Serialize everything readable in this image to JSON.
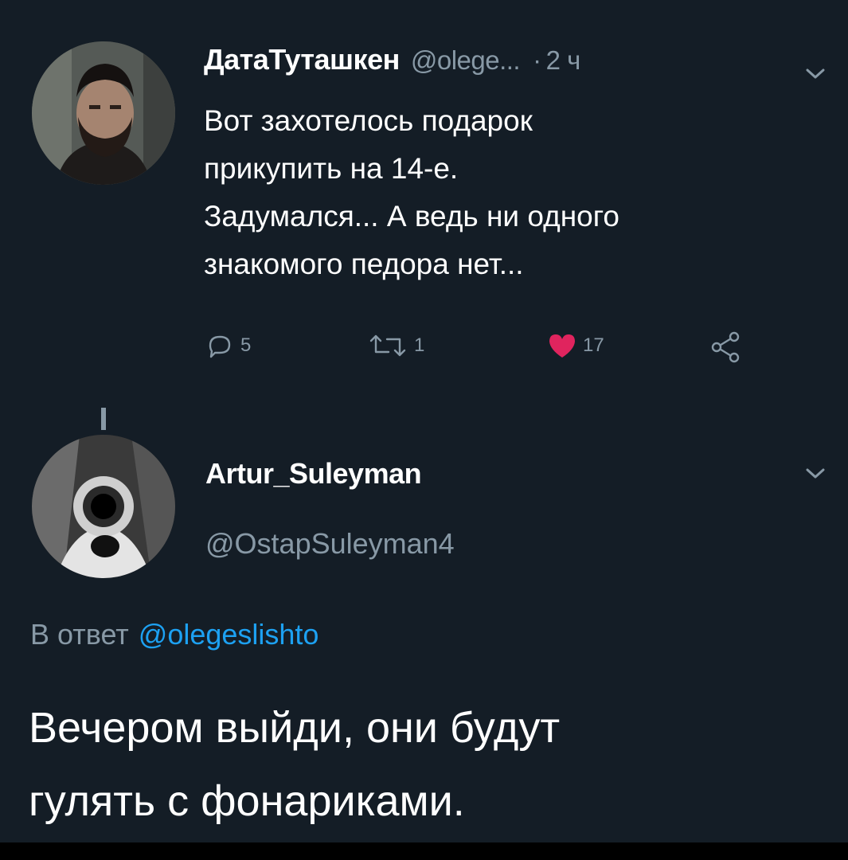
{
  "tweet": {
    "author_name": "ДатаТуташкен",
    "author_handle": "@olege...",
    "separator": "·",
    "time": "2 ч",
    "text": "Вот захотелось подарок\nприкупить на 14-е.\nЗадумался... А ведь ни одного\nзнакомого педора нет...",
    "avatar_icon": "bearded-man-avatar",
    "actions": {
      "reply_count": "5",
      "retweet_count": "1",
      "like_count": "17",
      "like_color": "#e0245e"
    }
  },
  "reply": {
    "author_name": "Artur_Suleyman",
    "author_handle": "@OstapSuleyman4",
    "avatar_icon": "gun-pointing-avatar",
    "reply_to_prefix": "В ответ",
    "reply_to_mention": "@olegeslishto",
    "text": "Вечером выйди, они будут\nгулять с фонариками."
  },
  "colors": {
    "background": "#141d26",
    "muted_text": "#8899a6",
    "link": "#1da1f2"
  }
}
